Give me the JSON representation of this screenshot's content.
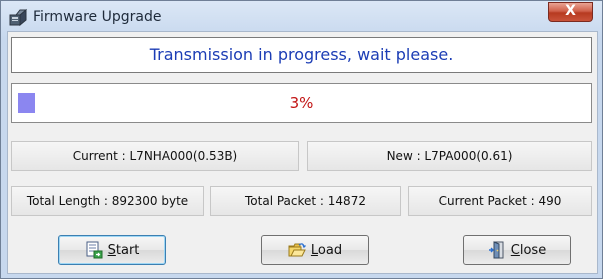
{
  "window": {
    "title": "Firmware Upgrade",
    "close_label": "X"
  },
  "status": {
    "message": "Transmission in progress, wait please."
  },
  "progress": {
    "percent": 3,
    "label": "3%"
  },
  "info": {
    "current": "Current : L7NHA000(0.53B)",
    "new": "New : L7PA000(0.61)",
    "total_length": "Total Length : 892300 byte",
    "total_packet": "Total Packet : 14872",
    "current_packet": "Current Packet : 490"
  },
  "buttons": {
    "start": {
      "mnemonic": "S",
      "rest": "tart",
      "icon": "start-document-icon"
    },
    "load": {
      "mnemonic": "L",
      "rest": "oad",
      "icon": "open-folder-icon"
    },
    "close": {
      "mnemonic": "C",
      "rest": "lose",
      "icon": "exit-door-icon"
    }
  },
  "colors": {
    "status_text": "#1c3db5",
    "progress_text": "#c21515",
    "progress_fill": "#8b86f0"
  }
}
